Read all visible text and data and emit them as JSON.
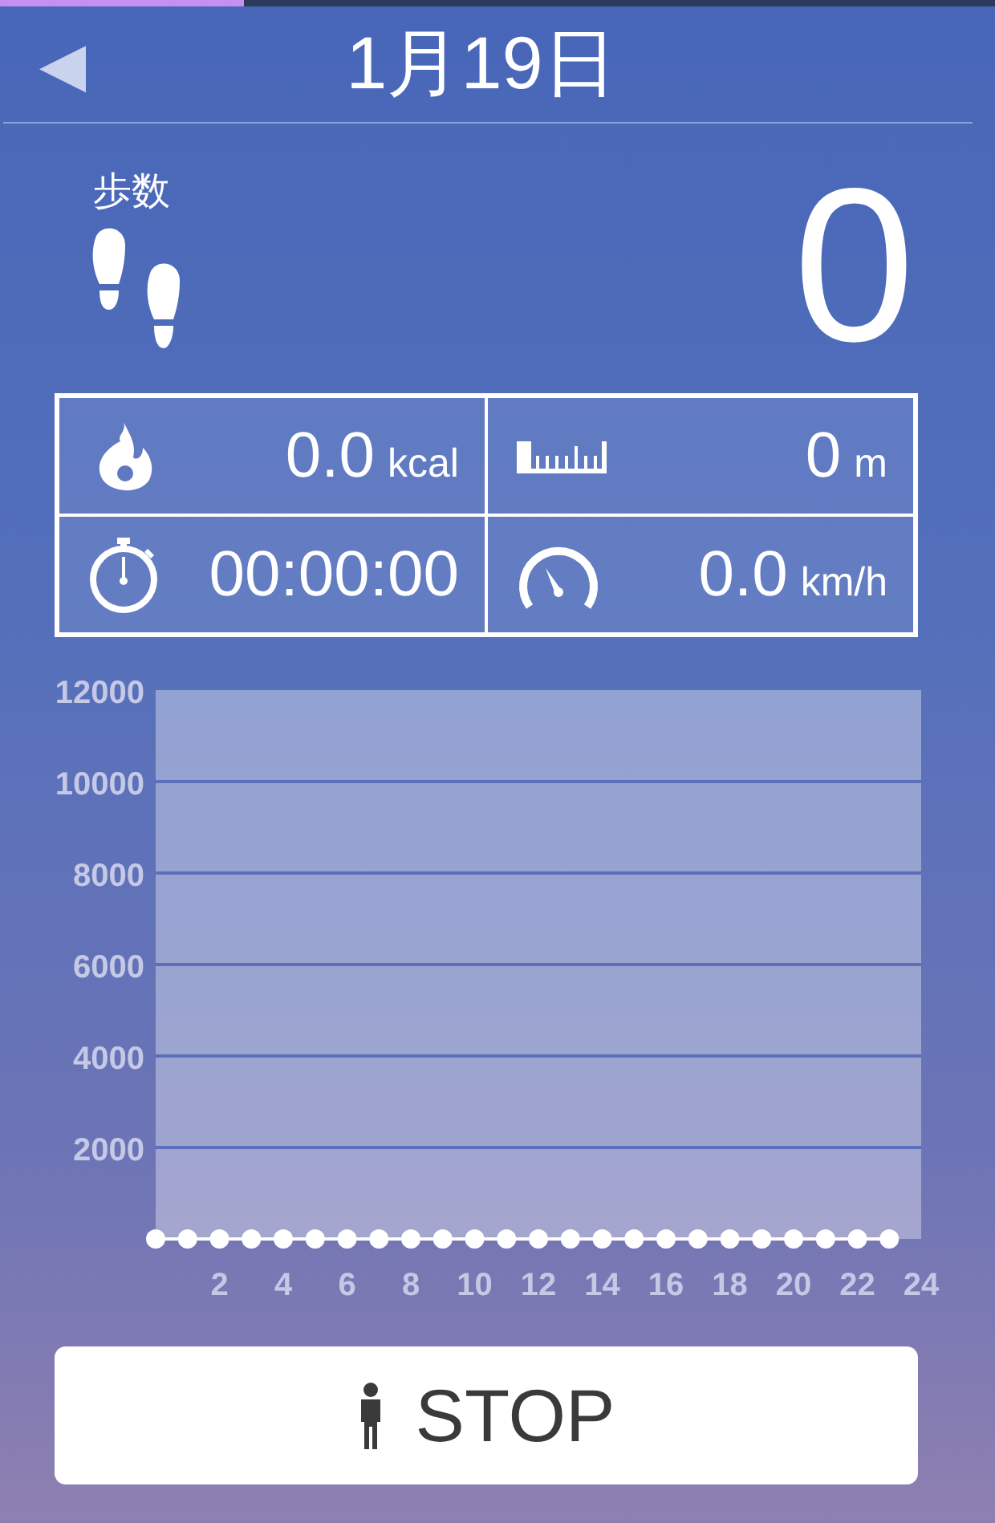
{
  "top_progress": {
    "level": 0.245
  },
  "header": {
    "back": "◀",
    "title": "1月19日"
  },
  "steps": {
    "label": "歩数",
    "value": "0"
  },
  "stats": [
    {
      "kind": "calories",
      "value": "0.0",
      "unit": "kcal"
    },
    {
      "kind": "distance",
      "value": "0",
      "unit": "m"
    },
    {
      "kind": "time",
      "value": "00:00:00"
    },
    {
      "kind": "speed",
      "value": "0.0",
      "unit": "km/h"
    }
  ],
  "chart_data": {
    "type": "line",
    "x": [
      0,
      1,
      2,
      3,
      4,
      5,
      6,
      7,
      8,
      9,
      10,
      11,
      12,
      13,
      14,
      15,
      16,
      17,
      18,
      19,
      20,
      21,
      22,
      23
    ],
    "grid": true,
    "series": [
      {
        "color": "#ffffff",
        "marker": true,
        "values": [
          0,
          0,
          0,
          0,
          0,
          0,
          0,
          0,
          0,
          0,
          0,
          0,
          0,
          0,
          0,
          0,
          0,
          0,
          0,
          0,
          0,
          0,
          0,
          0
        ]
      }
    ],
    "xlim": [
      0,
      24
    ],
    "ylim": [
      0,
      12000
    ],
    "xticks": [
      2,
      4,
      6,
      8,
      10,
      12,
      14,
      16,
      18,
      20,
      22,
      24
    ],
    "yticks": [
      2000,
      4000,
      6000,
      8000,
      10000,
      12000
    ]
  },
  "button": {
    "label": "STOP"
  }
}
